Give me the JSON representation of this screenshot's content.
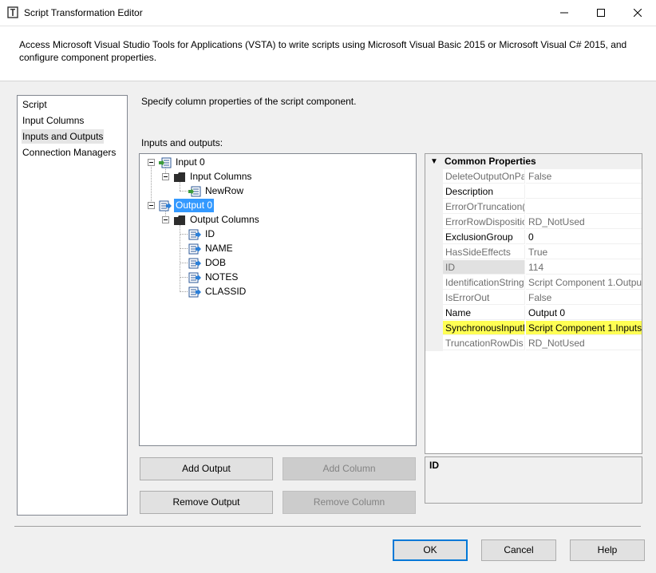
{
  "window": {
    "title": "Script Transformation Editor",
    "description": "Access Microsoft Visual Studio Tools for Applications (VSTA) to write scripts using Microsoft Visual Basic 2015 or Microsoft Visual C# 2015, and configure component properties."
  },
  "nav": {
    "items": [
      {
        "label": "Script"
      },
      {
        "label": "Input Columns"
      },
      {
        "label": "Inputs and Outputs",
        "selected": true
      },
      {
        "label": "Connection Managers"
      }
    ]
  },
  "main": {
    "subtitle": "Specify column properties of the script component.",
    "tree_label": "Inputs and outputs:"
  },
  "tree": {
    "input": {
      "label": "Input 0"
    },
    "input_columns": {
      "label": "Input Columns"
    },
    "input_col_items": [
      {
        "label": "NewRow"
      }
    ],
    "output": {
      "label": "Output 0",
      "selected": true
    },
    "output_columns": {
      "label": "Output Columns"
    },
    "output_col_items": [
      {
        "label": "ID"
      },
      {
        "label": "NAME"
      },
      {
        "label": "DOB"
      },
      {
        "label": "NOTES"
      },
      {
        "label": "CLASSID"
      }
    ]
  },
  "properties": {
    "category": "Common Properties",
    "rows": [
      {
        "name": "DeleteOutputOnPa",
        "value": "False",
        "readonly": true
      },
      {
        "name": "Description",
        "value": "",
        "readonly": false
      },
      {
        "name": "ErrorOrTruncation(",
        "value": "",
        "readonly": true
      },
      {
        "name": "ErrorRowDispositio",
        "value": "RD_NotUsed",
        "readonly": true
      },
      {
        "name": "ExclusionGroup",
        "value": "0",
        "readonly": false
      },
      {
        "name": "HasSideEffects",
        "value": "True",
        "readonly": true
      },
      {
        "name": "ID",
        "value": "114",
        "readonly": true
      },
      {
        "name": "IdentificationString",
        "value": "Script Component 1.Outpu",
        "readonly": true
      },
      {
        "name": "IsErrorOut",
        "value": "False",
        "readonly": true
      },
      {
        "name": "Name",
        "value": "Output 0",
        "readonly": false
      },
      {
        "name": "SynchronousInputI",
        "value": "Script Component 1.Inputs",
        "readonly": false,
        "highlighted": true
      },
      {
        "name": "TruncationRowDis",
        "value": "RD_NotUsed",
        "readonly": true
      }
    ],
    "description_title": "ID",
    "highlight_color": "#ffff54"
  },
  "buttons": {
    "add_output": "Add Output",
    "add_column": "Add Column",
    "remove_output": "Remove Output",
    "remove_column": "Remove Column",
    "ok": "OK",
    "cancel": "Cancel",
    "help": "Help"
  },
  "colors": {
    "selection": "#3399ff",
    "focus_border": "#0078d7"
  }
}
